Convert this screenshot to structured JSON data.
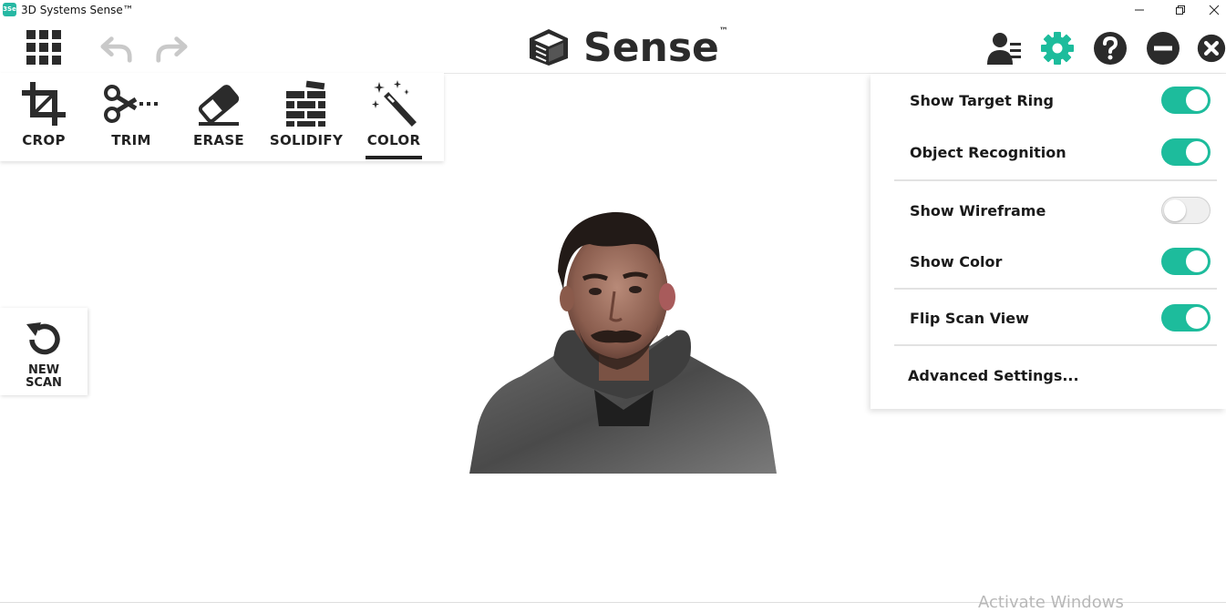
{
  "window": {
    "title": "3D Systems Sense™",
    "app_icon_text": "3Se"
  },
  "header": {
    "brand_name": "Sense",
    "brand_tm": "™"
  },
  "tools": [
    {
      "label": "CROP",
      "icon": "crop-icon"
    },
    {
      "label": "TRIM",
      "icon": "scissors-icon"
    },
    {
      "label": "ERASE",
      "icon": "eraser-icon"
    },
    {
      "label": "SOLIDIFY",
      "icon": "bricks-icon"
    },
    {
      "label": "COLOR",
      "icon": "magic-wand-icon",
      "active": true
    }
  ],
  "new_scan": {
    "line1": "NEW",
    "line2": "SCAN"
  },
  "settings": {
    "items": [
      {
        "label": "Show Target Ring",
        "on": true
      },
      {
        "label": "Object Recognition",
        "on": true
      },
      {
        "label": "Show Wireframe",
        "on": false
      },
      {
        "label": "Show Color",
        "on": true
      },
      {
        "label": "Flip Scan View",
        "on": true
      }
    ],
    "advanced_label": "Advanced Settings..."
  },
  "watermark": "Activate Windows",
  "colors": {
    "accent": "#1dbc9c",
    "text": "#222222"
  }
}
